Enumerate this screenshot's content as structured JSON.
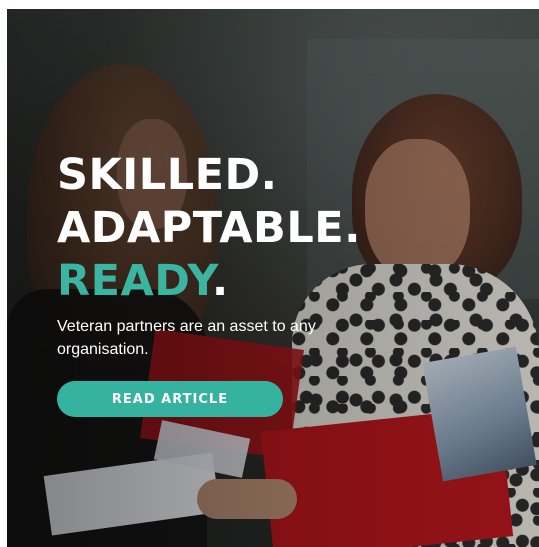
{
  "hero": {
    "headline_line1": "SKILLED.",
    "headline_line2": "ADAPTABLE.",
    "headline_line3_accent": "READY",
    "headline_line3_period": ".",
    "subtitle": "Veteran partners are an asset to any organisation.",
    "cta_label": "READ ARTICLE"
  },
  "colors": {
    "accent": "#3ab5a1",
    "text": "#ffffff"
  }
}
